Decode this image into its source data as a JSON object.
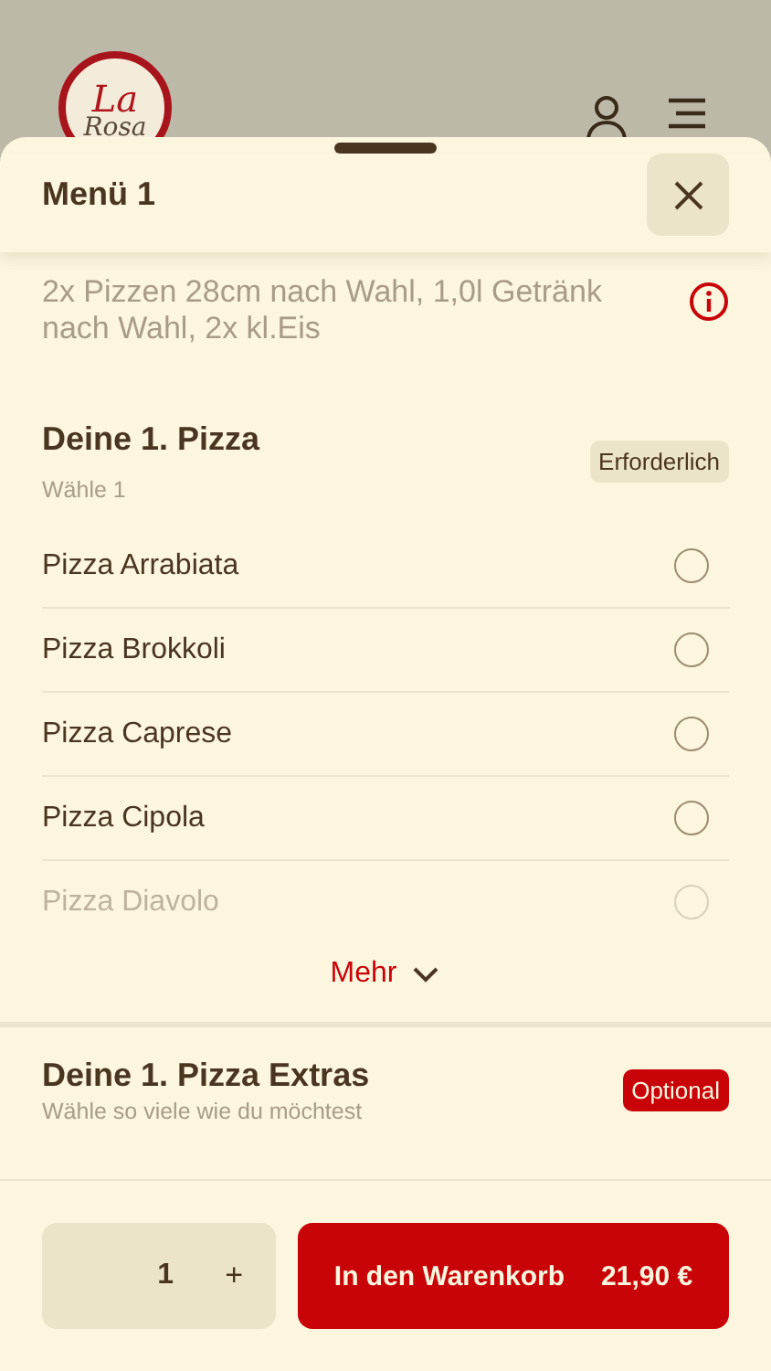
{
  "header": {
    "logo": {
      "line_1": "La",
      "line_2": "Rosa"
    }
  },
  "sheet": {
    "title": "Menü 1",
    "description": "2x Pizzen 28cm nach Wahl, 1,0l Getränk nach Wahl, 2x kl.Eis",
    "groups": [
      {
        "title": "Deine 1. Pizza",
        "subtitle": "Wähle 1",
        "badge": {
          "label": "Erforderlich",
          "kind": "required"
        },
        "options": [
          {
            "label": "Pizza Arrabiata",
            "selected": false,
            "faded": false
          },
          {
            "label": "Pizza Brokkoli",
            "selected": false,
            "faded": false
          },
          {
            "label": "Pizza Caprese",
            "selected": false,
            "faded": false
          },
          {
            "label": "Pizza Cipola",
            "selected": false,
            "faded": false
          },
          {
            "label": "Pizza Diavolo",
            "selected": false,
            "faded": true
          }
        ],
        "more": "Mehr"
      },
      {
        "title": "Deine 1. Pizza Extras",
        "subtitle": "Wähle so viele wie du möchtest",
        "badge": {
          "label": "Optional",
          "kind": "optional"
        }
      }
    ]
  },
  "footer": {
    "quantity": "1",
    "plus": "+",
    "cart_button": {
      "label": "In den Warenkorb",
      "price": "21,90 €"
    }
  }
}
